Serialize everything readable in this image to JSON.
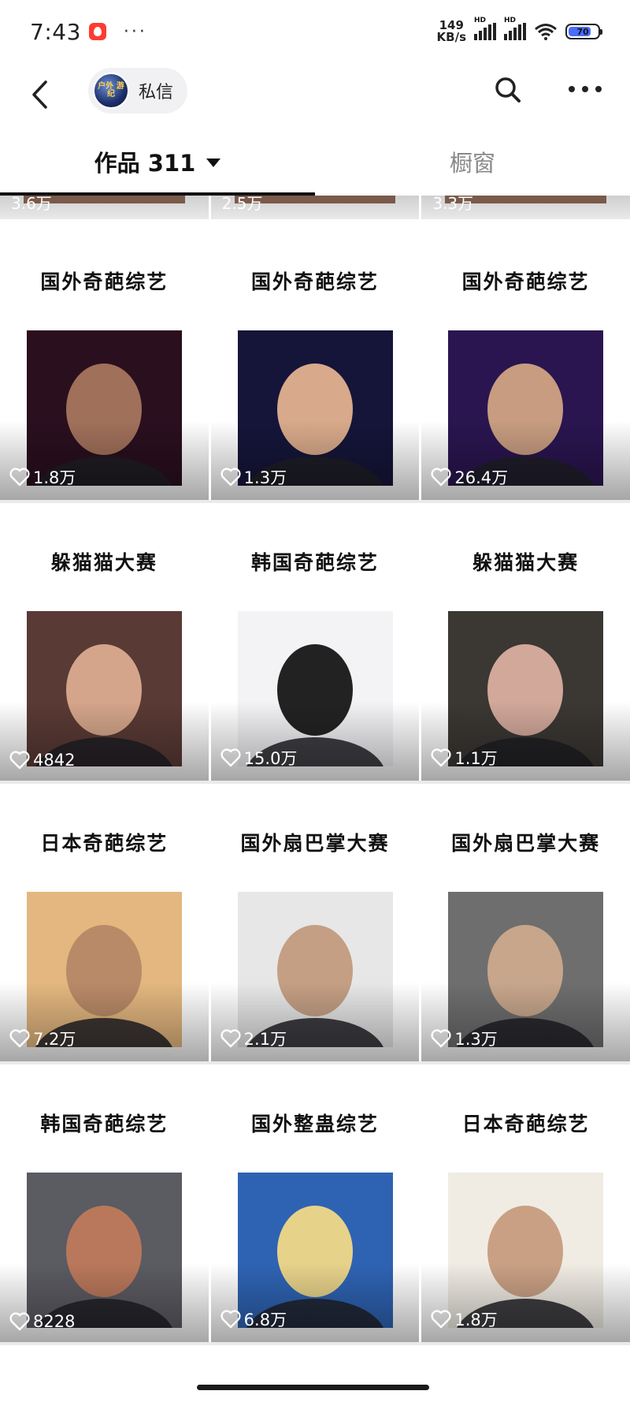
{
  "status_bar": {
    "time": "7:43",
    "net_speed_value": "149",
    "net_speed_unit": "KB/s",
    "sim1_label": "HD",
    "sim2_label": "HD",
    "battery_level": "70"
  },
  "header": {
    "back_icon": "chevron-left-icon",
    "dm_label": "私信",
    "dm_avatar_text": "户外 游纪",
    "search_icon": "search-icon",
    "more_icon": "more-horizontal-icon"
  },
  "tabs": {
    "works_label": "作品 311",
    "window_label": "橱窗",
    "active": "works"
  },
  "cut_row": [
    "3.6万",
    "2.5万",
    "3.3万"
  ],
  "rows": [
    [
      {
        "title": "国外奇葩综艺",
        "likes": "1.8万",
        "bg": "#2a0f1f",
        "accent": "#a0705a"
      },
      {
        "title": "国外奇葩综艺",
        "likes": "1.3万",
        "bg": "#15153a",
        "accent": "#d8a98a"
      },
      {
        "title": "国外奇葩综艺",
        "likes": "26.4万",
        "bg": "#2a1550",
        "accent": "#c79c80"
      }
    ],
    [
      {
        "title": "躲猫猫大赛",
        "likes": "4842",
        "bg": "#5a3a35",
        "accent": "#d4a58a"
      },
      {
        "title": "韩国奇葩综艺",
        "likes": "15.0万",
        "bg": "#f3f3f6",
        "accent": "#222222"
      },
      {
        "title": "躲猫猫大赛",
        "likes": "1.1万",
        "bg": "#3b3733",
        "accent": "#d1a89a"
      }
    ],
    [
      {
        "title": "日本奇葩综艺",
        "likes": "7.2万",
        "bg": "#e3b77f",
        "accent": "#b98a68"
      },
      {
        "title": "国外扇巴掌大赛",
        "likes": "2.1万",
        "bg": "#e7e7e7",
        "accent": "#c49f84"
      },
      {
        "title": "国外扇巴掌大赛",
        "likes": "1.3万",
        "bg": "#6e6e6e",
        "accent": "#c7a68b"
      }
    ],
    [
      {
        "title": "韩国奇葩综艺",
        "likes": "8228",
        "bg": "#5b5b62",
        "accent": "#b9785b"
      },
      {
        "title": "国外整蛊综艺",
        "likes": "6.8万",
        "bg": "#2e63b3",
        "accent": "#e7d28a"
      },
      {
        "title": "日本奇葩综艺",
        "likes": "1.8万",
        "bg": "#f0ece4",
        "accent": "#c9a084"
      }
    ]
  ]
}
